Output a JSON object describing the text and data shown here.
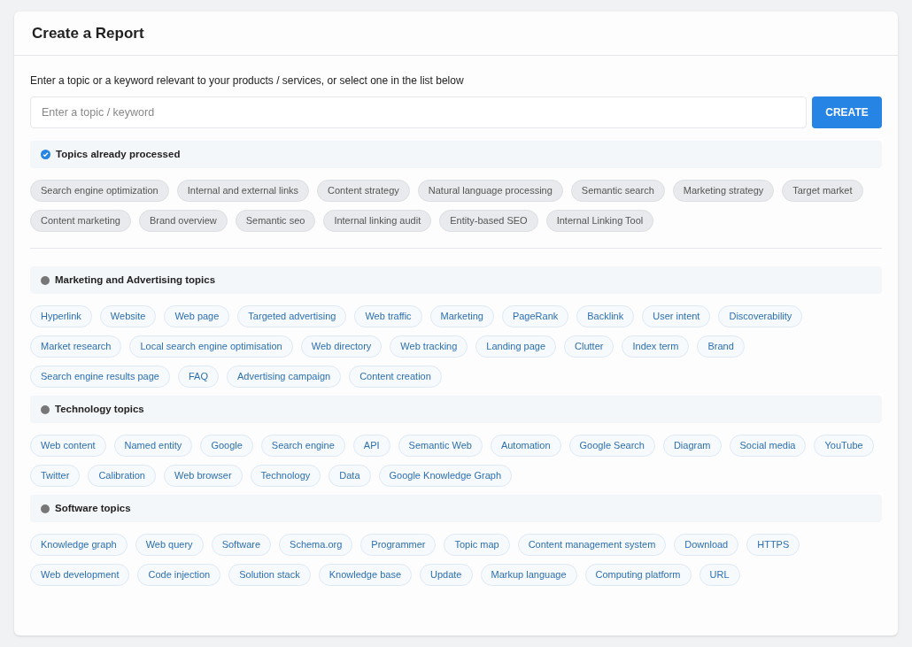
{
  "title": "Create a Report",
  "instructions": "Enter a topic or a keyword relevant to your products / services, or select one in the list below",
  "search": {
    "placeholder": "Enter a topic / keyword"
  },
  "create_button": "CREATE",
  "sections": [
    {
      "kind": "processed",
      "title": "Topics already processed",
      "topics": [
        "Search engine optimization",
        "Internal and external links",
        "Content strategy",
        "Natural language processing",
        "Semantic search",
        "Marketing strategy",
        "Target market",
        "Content marketing",
        "Brand overview",
        "Semantic seo",
        "Internal linking audit",
        "Entity-based SEO",
        "Internal Linking Tool"
      ]
    },
    {
      "kind": "category",
      "title": "Marketing and Advertising topics",
      "topics": [
        "Hyperlink",
        "Website",
        "Web page",
        "Targeted advertising",
        "Web traffic",
        "Marketing",
        "PageRank",
        "Backlink",
        "User intent",
        "Discoverability",
        "Market research",
        "Local search engine optimisation",
        "Web directory",
        "Web tracking",
        "Landing page",
        "Clutter",
        "Index term",
        "Brand",
        "Search engine results page",
        "FAQ",
        "Advertising campaign",
        "Content creation"
      ]
    },
    {
      "kind": "category",
      "title": "Technology topics",
      "topics": [
        "Web content",
        "Named entity",
        "Google",
        "Search engine",
        "API",
        "Semantic Web",
        "Automation",
        "Google Search",
        "Diagram",
        "Social media",
        "YouTube",
        "Twitter",
        "Calibration",
        "Web browser",
        "Technology",
        "Data",
        "Google Knowledge Graph"
      ]
    },
    {
      "kind": "category",
      "title": "Software topics",
      "topics": [
        "Knowledge graph",
        "Web query",
        "Software",
        "Schema.org",
        "Programmer",
        "Topic map",
        "Content management system",
        "Download",
        "HTTPS",
        "Web development",
        "Code injection",
        "Solution stack",
        "Knowledge base",
        "Update",
        "Markup language",
        "Computing platform",
        "URL"
      ]
    }
  ]
}
